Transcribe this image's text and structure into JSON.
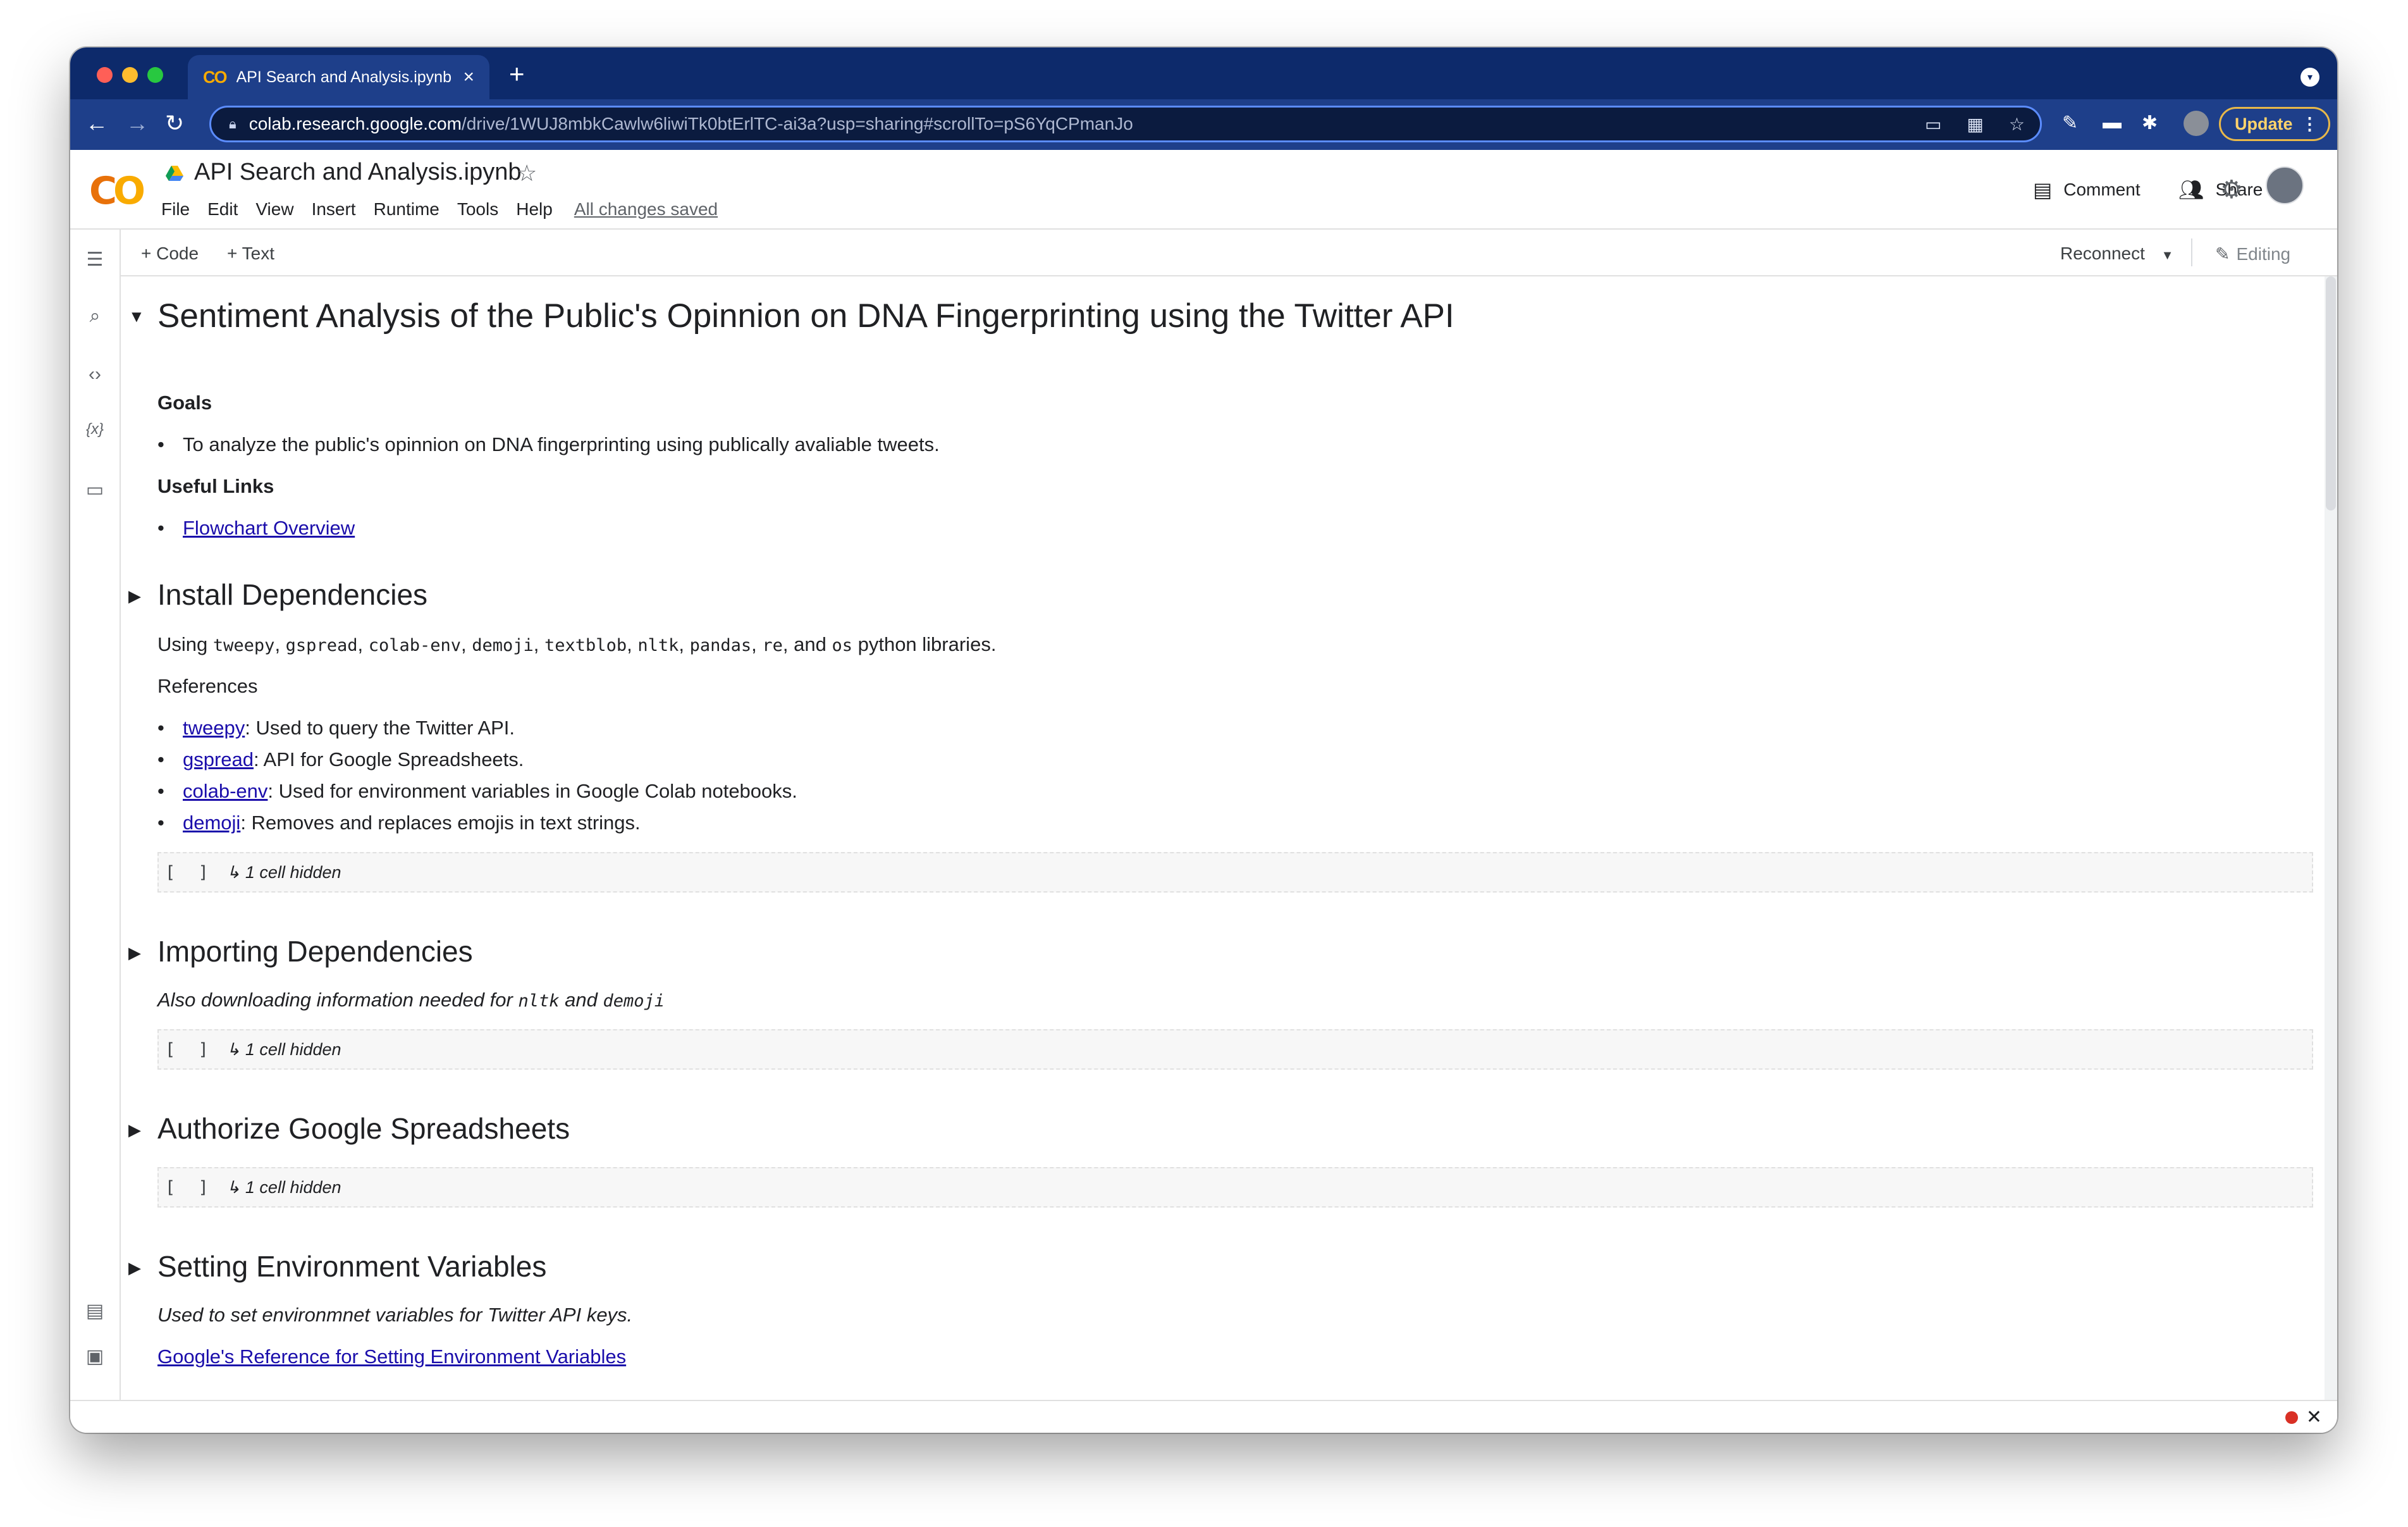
{
  "browser": {
    "tab_title": "API Search and Analysis.ipynb",
    "tab_close": "×",
    "new_tab": "+",
    "url_host": "colab.research.google.com",
    "url_path": "/drive/1WUJ8mbkCawlw6liwiTk0btErlTC-ai3a?usp=sharing#scrollTo=pS6YqCPmanJo",
    "update_label": "Update",
    "colors": {
      "frame": "#0d2a6b",
      "toolbar": "#1e3f8a",
      "update_border": "#e8b84a"
    }
  },
  "header": {
    "logo_text": "CO",
    "notebook_title": "API Search and Analysis.ipynb",
    "menu": [
      "File",
      "Edit",
      "View",
      "Insert",
      "Runtime",
      "Tools",
      "Help"
    ],
    "saved_status": "All changes saved",
    "comment_label": "Comment",
    "share_label": "Share"
  },
  "cell_toolbar": {
    "add_code": "Code",
    "add_text": "Text",
    "reconnect": "Reconnect",
    "editing": "Editing"
  },
  "notebook": {
    "title": "Sentiment Analysis of the Public's Opinnion on DNA Fingerprinting using the Twitter API",
    "goals_heading": "Goals",
    "goal_item": "To analyze the public's opinnion on DNA fingerprinting using publically avaliable tweets.",
    "links_heading": "Useful Links",
    "flowchart_link": "Flowchart Overview",
    "install": {
      "heading": "Install Dependencies",
      "using_prefix": "Using",
      "libs": [
        "tweepy",
        "gspread",
        "colab-env",
        "demoji",
        "textblob",
        "nltk",
        "pandas",
        "re"
      ],
      "and_word": ", and",
      "last_lib": "os",
      "using_suffix": "python libraries.",
      "references_label": "References",
      "refs": [
        {
          "name": "tweepy",
          "desc": ": Used to query the Twitter API."
        },
        {
          "name": "gspread",
          "desc": ": API for Google Spreadsheets."
        },
        {
          "name": "colab-env",
          "desc": ": Used for environment variables in Google Colab notebooks."
        },
        {
          "name": "demoji",
          "desc": ": Removes and replaces emojis in text strings."
        }
      ]
    },
    "hidden_cell_brackets": "[ ]",
    "hidden_cell_text": "↳ 1 cell hidden",
    "importing": {
      "heading": "Importing Dependencies",
      "note_prefix": "Also downloading information needed for",
      "note_lib1": "nltk",
      "note_and": "and",
      "note_lib2": "demoji"
    },
    "authorize": {
      "heading": "Authorize Google Spreadsheets"
    },
    "env": {
      "heading": "Setting Environment Variables",
      "note": "Used to set environmnet variables for Twitter API keys.",
      "link": "Google's Reference for Setting Environment Variables"
    }
  }
}
